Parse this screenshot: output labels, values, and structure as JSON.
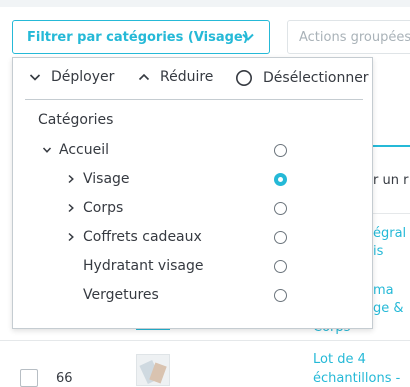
{
  "filter": {
    "label": "Filtrer par catégories (Visage)",
    "icon": "chevron-down-icon"
  },
  "bulk_actions": {
    "label": "Actions groupées"
  },
  "dropdown": {
    "toolbar": {
      "expand": "Déployer",
      "collapse": "Réduire",
      "deselect": "Désélectionner"
    },
    "tree_title": "Catégories",
    "root": {
      "label": "Accueil",
      "expanded": true,
      "selected": false
    },
    "children": [
      {
        "label": "Visage",
        "has_children": true,
        "selected": true
      },
      {
        "label": "Corps",
        "has_children": true,
        "selected": false
      },
      {
        "label": "Coffrets cadeaux",
        "has_children": true,
        "selected": false
      },
      {
        "label": "Hydratant visage",
        "has_children": false,
        "selected": false
      },
      {
        "label": "Vergetures",
        "has_children": false,
        "selected": false
      }
    ]
  },
  "background": {
    "cells": [
      "r un r",
      "égral",
      "is",
      "ma",
      "ge &",
      "Corps"
    ],
    "row": {
      "id": "66",
      "name_line1": "Lot de 4",
      "name_line2": "échantillons -"
    }
  },
  "colors": {
    "accent": "#25b9d7",
    "text": "#363a41",
    "disabled": "#a9b2b8"
  }
}
